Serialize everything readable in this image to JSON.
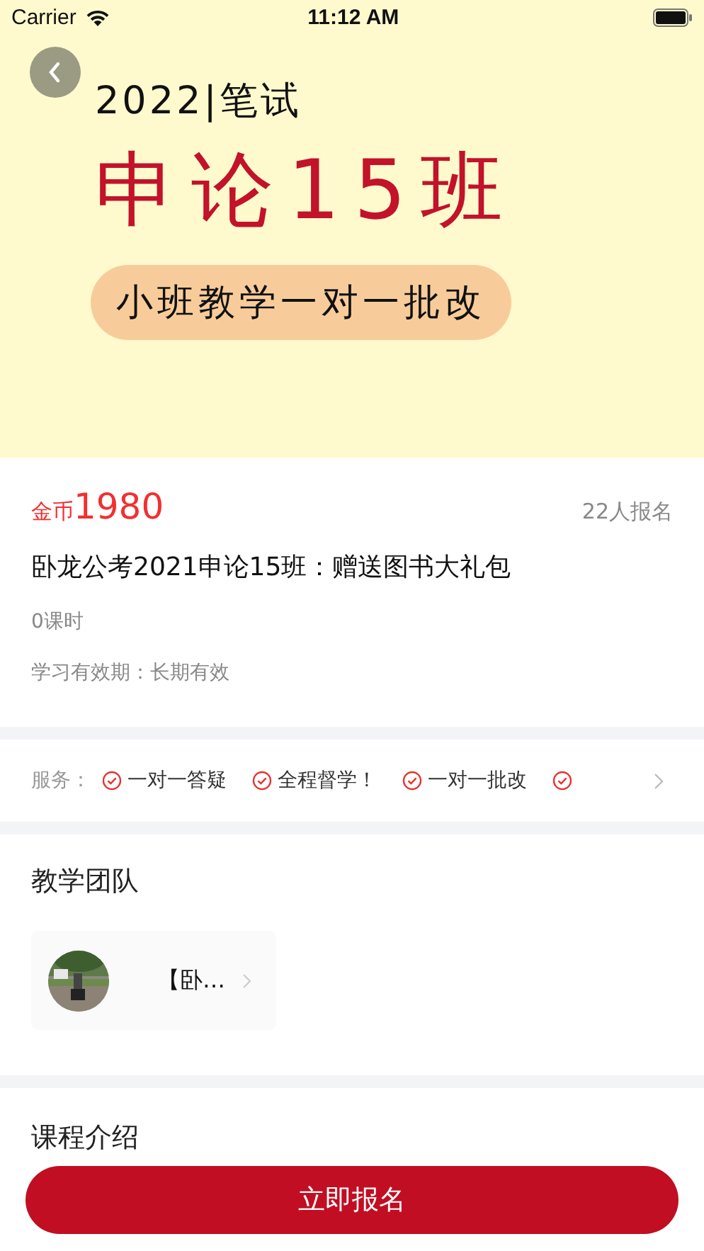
{
  "status_bar": {
    "carrier": "Carrier",
    "time": "11:12 AM"
  },
  "banner": {
    "year_line": "2022|笔试",
    "title": "申论15班",
    "tagline": "小班教学一对一批改"
  },
  "course": {
    "currency": "金币",
    "price": "1980",
    "enrolled": "22人报名",
    "name": "卧龙公考2021申论15班：赠送图书大礼包",
    "lessons": "0课时",
    "validity": "学习有效期：长期有效"
  },
  "services": {
    "label": "服务：",
    "items": [
      {
        "text": "一对一答疑"
      },
      {
        "text": "全程督学！"
      },
      {
        "text": "一对一批改"
      }
    ],
    "more_check": true
  },
  "team": {
    "title": "教学团队",
    "teachers": [
      {
        "name": "【卧…"
      }
    ]
  },
  "intro": {
    "title": "课程介绍"
  },
  "enroll_button": "立即报名"
}
